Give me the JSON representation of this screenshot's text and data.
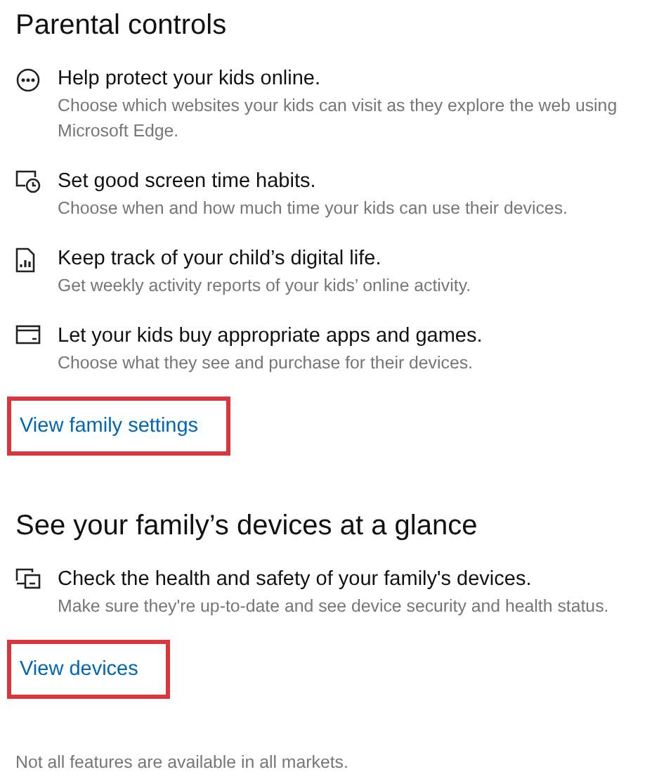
{
  "sections": [
    {
      "heading": "Parental controls",
      "items": [
        {
          "kind": "ellipsis",
          "title": "Help protect your kids online.",
          "description": "Choose which websites your kids can visit as they explore the web using Microsoft Edge."
        },
        {
          "kind": "clock",
          "title": "Set good screen time habits.",
          "description": "Choose when and how much time your kids can use their devices."
        },
        {
          "kind": "report",
          "title": "Keep track of your child’s digital life.",
          "description": "Get weekly activity reports of your kids’ online activity."
        },
        {
          "kind": "card",
          "title": "Let your kids buy appropriate apps and games.",
          "description": "Choose what they see and purchase for their devices."
        }
      ],
      "link": {
        "label": "View family settings",
        "highlighted": true
      }
    },
    {
      "heading": "See your family’s devices at a glance",
      "items": [
        {
          "kind": "devices",
          "title": "Check the health and safety of your family's devices.",
          "description": "Make sure they're up-to-date and see device security and health status."
        }
      ],
      "link": {
        "label": "View devices",
        "highlighted": true
      }
    }
  ],
  "footnote": "Not all features are available in all markets."
}
